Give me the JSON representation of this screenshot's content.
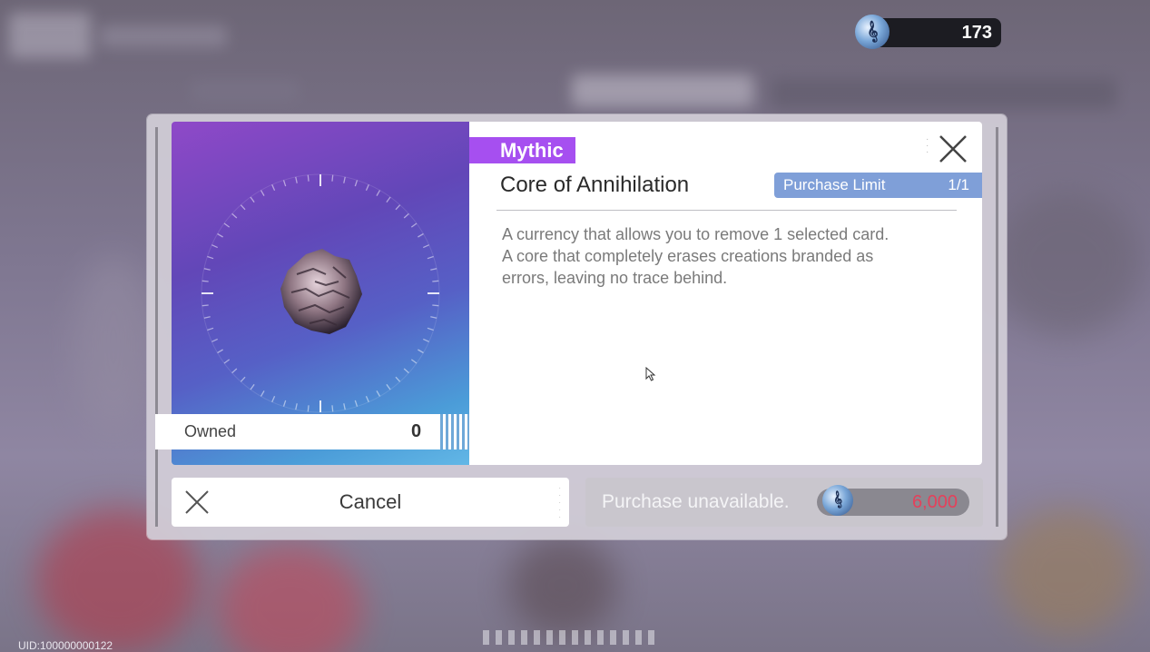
{
  "currency": {
    "amount": "173",
    "icon": "music-note-token-icon"
  },
  "item": {
    "rarity": "Mythic",
    "name": "Core of Annihilation",
    "purchase_limit_label": "Purchase Limit",
    "purchase_limit_value": "1/1",
    "description_lines": [
      "A currency that allows you to remove 1 selected card.",
      "A core that completely erases creations branded as",
      "errors, leaving no trace behind."
    ],
    "owned_label": "Owned",
    "owned_value": "0"
  },
  "actions": {
    "cancel_label": "Cancel",
    "purchase_label": "Purchase unavailable.",
    "price": "6,000"
  },
  "footer": {
    "uid": "UID:100000000122"
  },
  "colors": {
    "rarity": "#a64ff0",
    "limit_badge": "#7f9fd8",
    "price_unavailable": "#e4415b"
  }
}
